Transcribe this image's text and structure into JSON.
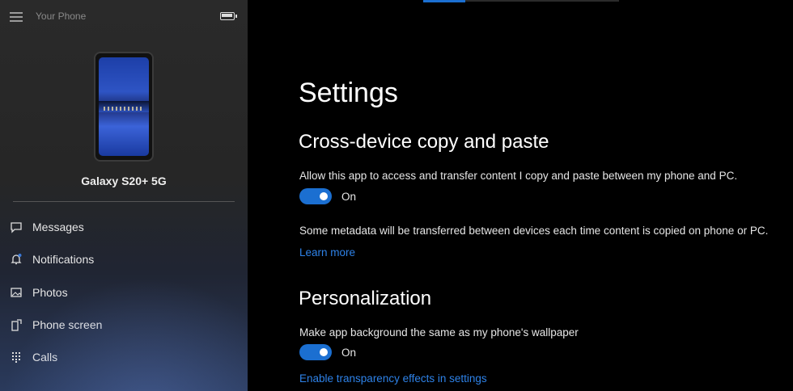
{
  "app": {
    "title": "Your Phone"
  },
  "device": {
    "name": "Galaxy S20+ 5G"
  },
  "sidebar": {
    "items": [
      {
        "label": "Messages",
        "icon": "message-icon"
      },
      {
        "label": "Notifications",
        "icon": "bell-icon"
      },
      {
        "label": "Photos",
        "icon": "photo-icon"
      },
      {
        "label": "Phone screen",
        "icon": "phone-screen-icon"
      },
      {
        "label": "Calls",
        "icon": "dialpad-icon"
      }
    ]
  },
  "settings": {
    "title": "Settings",
    "copy_paste": {
      "heading": "Cross-device copy and paste",
      "description": "Allow this app to access and transfer content I copy and paste between my phone and PC.",
      "toggle_state": "On",
      "metadata_note": "Some metadata will be transferred between devices each time content is copied on phone or PC.",
      "learn_more": "Learn more"
    },
    "personalization": {
      "heading": "Personalization",
      "description": "Make app background the same as my phone's wallpaper",
      "toggle_state": "On",
      "transparency_link": "Enable transparency effects in settings"
    }
  },
  "colors": {
    "accent": "#1b6fd1",
    "link": "#2e82e8",
    "sidebar_bg": "#2a2a2a",
    "main_bg": "#000000"
  }
}
